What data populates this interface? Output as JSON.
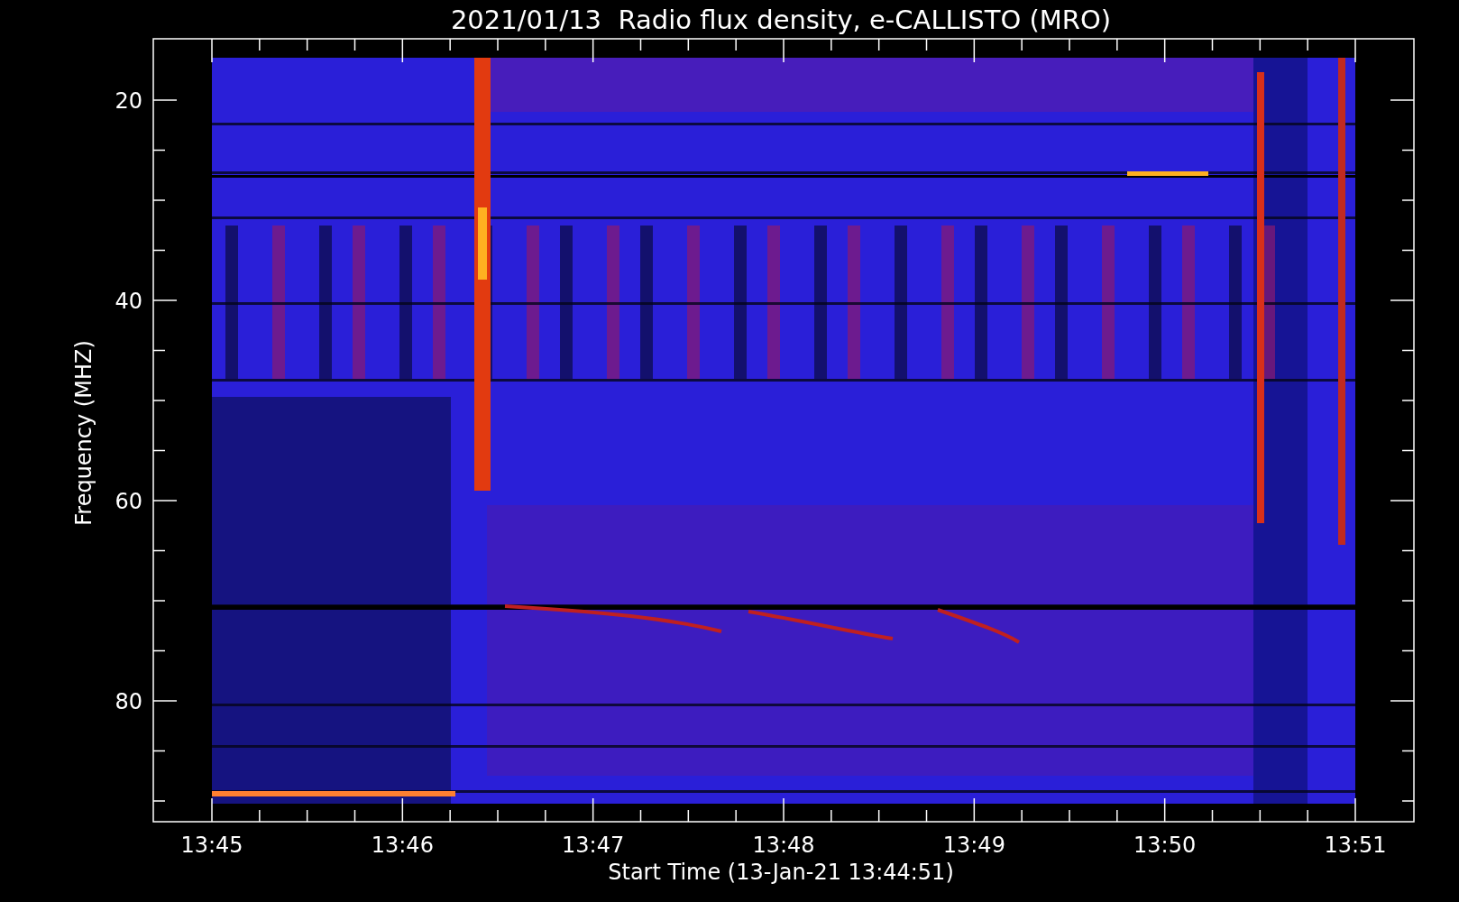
{
  "title": "2021/01/13  Radio flux density, e-CALLISTO (MRO)",
  "y_axis": {
    "label": "Frequency (MHZ)",
    "ticks": [
      "20",
      "40",
      "60",
      "80"
    ]
  },
  "x_axis": {
    "label": "Start Time (13-Jan-21 13:44:51)",
    "ticks": [
      "13:45",
      "13:46",
      "13:47",
      "13:48",
      "13:49",
      "13:50",
      "13:51"
    ]
  }
}
